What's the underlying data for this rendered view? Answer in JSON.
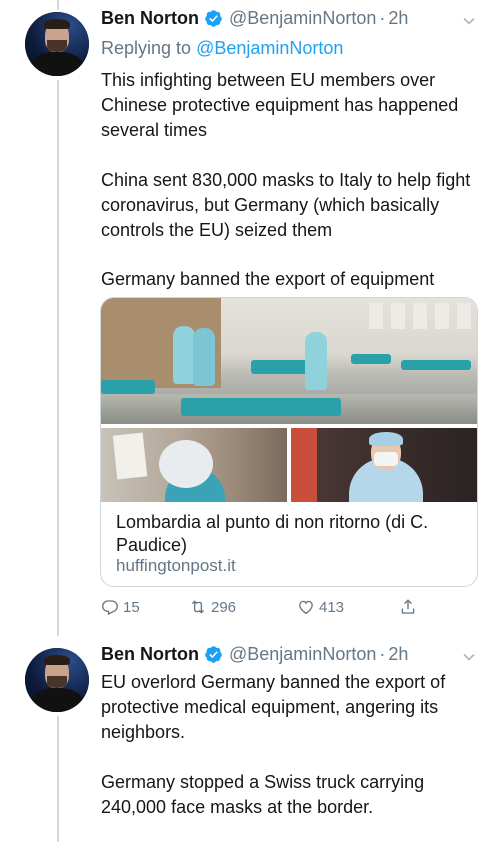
{
  "tweets": [
    {
      "name": "Ben Norton",
      "handle": "@BenjaminNorton",
      "separator": "·",
      "time": "2h",
      "replying_prefix": "Replying to",
      "replying_handle": "@BenjaminNorton",
      "paragraphs": [
        "This infighting between EU members over Chinese protective equipment has happened several times",
        "China sent 830,000 masks to Italy to help fight coronavirus, but Germany (which basically controls the EU) seized  them",
        "Germany banned the export of equipment"
      ],
      "card": {
        "title": "Lombardia al punto di non ritorno (di C. Paudice)",
        "domain": "huffingtonpost.it"
      },
      "actions": {
        "replies": "15",
        "retweets": "296",
        "likes": "413"
      }
    },
    {
      "name": "Ben Norton",
      "handle": "@BenjaminNorton",
      "separator": "·",
      "time": "2h",
      "paragraphs": [
        "EU overlord Germany banned the export of protective medical equipment, angering its neighbors.",
        "Germany stopped a Swiss truck carrying 240,000 face masks at the border."
      ]
    }
  ],
  "colors": {
    "verified_blue": "#1da1f2",
    "link_blue": "#1da1f2",
    "secondary_gray": "#657786",
    "thread_line": "#cfd9de"
  },
  "icons": [
    "verified-badge-icon",
    "chevron-down-icon",
    "reply-icon",
    "retweet-icon",
    "like-icon",
    "share-icon"
  ]
}
